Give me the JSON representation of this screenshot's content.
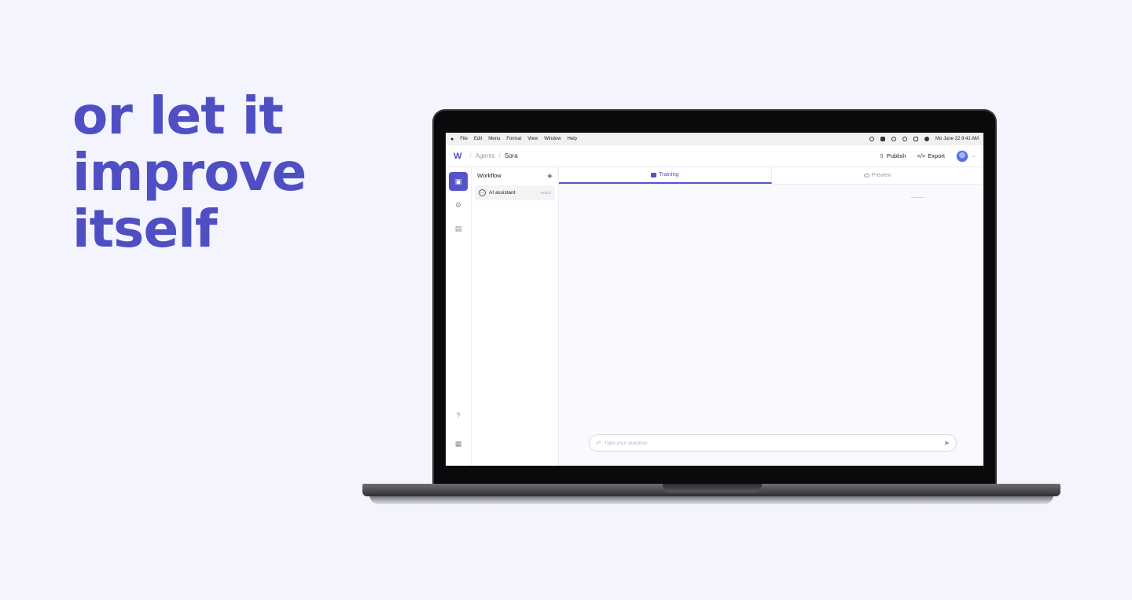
{
  "headline": [
    "or let it",
    "improve",
    "itself"
  ],
  "menubar": {
    "items": [
      "File",
      "Edit",
      "Menu",
      "Format",
      "View",
      "Window",
      "Help"
    ],
    "clock": "Mo June 22  9:41 AM"
  },
  "header": {
    "breadcrumb_root": "Agents",
    "breadcrumb_current": "Sora",
    "publish_label": "Publish",
    "export_label": "Export"
  },
  "workflow": {
    "title": "Workflow",
    "items": [
      {
        "label": "AI assistant",
        "tag": "default"
      }
    ]
  },
  "tabs": [
    {
      "label": "Training",
      "active": true
    },
    {
      "label": "Preview",
      "active": false
    }
  ],
  "chat": {
    "placeholder": "Type your question"
  },
  "colors": {
    "accent": "#4f4fc3",
    "background": "#f3f4fd"
  }
}
